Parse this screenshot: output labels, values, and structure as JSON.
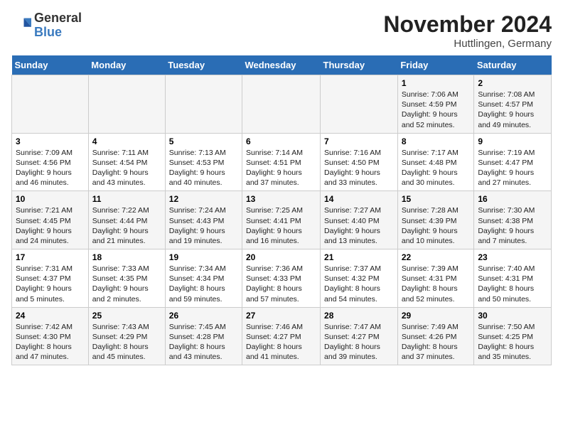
{
  "header": {
    "logo_general": "General",
    "logo_blue": "Blue",
    "month_title": "November 2024",
    "location": "Huttlingen, Germany"
  },
  "days_of_week": [
    "Sunday",
    "Monday",
    "Tuesday",
    "Wednesday",
    "Thursday",
    "Friday",
    "Saturday"
  ],
  "weeks": [
    [
      {
        "day": "",
        "info": ""
      },
      {
        "day": "",
        "info": ""
      },
      {
        "day": "",
        "info": ""
      },
      {
        "day": "",
        "info": ""
      },
      {
        "day": "",
        "info": ""
      },
      {
        "day": "1",
        "info": "Sunrise: 7:06 AM\nSunset: 4:59 PM\nDaylight: 9 hours and 52 minutes."
      },
      {
        "day": "2",
        "info": "Sunrise: 7:08 AM\nSunset: 4:57 PM\nDaylight: 9 hours and 49 minutes."
      }
    ],
    [
      {
        "day": "3",
        "info": "Sunrise: 7:09 AM\nSunset: 4:56 PM\nDaylight: 9 hours and 46 minutes."
      },
      {
        "day": "4",
        "info": "Sunrise: 7:11 AM\nSunset: 4:54 PM\nDaylight: 9 hours and 43 minutes."
      },
      {
        "day": "5",
        "info": "Sunrise: 7:13 AM\nSunset: 4:53 PM\nDaylight: 9 hours and 40 minutes."
      },
      {
        "day": "6",
        "info": "Sunrise: 7:14 AM\nSunset: 4:51 PM\nDaylight: 9 hours and 37 minutes."
      },
      {
        "day": "7",
        "info": "Sunrise: 7:16 AM\nSunset: 4:50 PM\nDaylight: 9 hours and 33 minutes."
      },
      {
        "day": "8",
        "info": "Sunrise: 7:17 AM\nSunset: 4:48 PM\nDaylight: 9 hours and 30 minutes."
      },
      {
        "day": "9",
        "info": "Sunrise: 7:19 AM\nSunset: 4:47 PM\nDaylight: 9 hours and 27 minutes."
      }
    ],
    [
      {
        "day": "10",
        "info": "Sunrise: 7:21 AM\nSunset: 4:45 PM\nDaylight: 9 hours and 24 minutes."
      },
      {
        "day": "11",
        "info": "Sunrise: 7:22 AM\nSunset: 4:44 PM\nDaylight: 9 hours and 21 minutes."
      },
      {
        "day": "12",
        "info": "Sunrise: 7:24 AM\nSunset: 4:43 PM\nDaylight: 9 hours and 19 minutes."
      },
      {
        "day": "13",
        "info": "Sunrise: 7:25 AM\nSunset: 4:41 PM\nDaylight: 9 hours and 16 minutes."
      },
      {
        "day": "14",
        "info": "Sunrise: 7:27 AM\nSunset: 4:40 PM\nDaylight: 9 hours and 13 minutes."
      },
      {
        "day": "15",
        "info": "Sunrise: 7:28 AM\nSunset: 4:39 PM\nDaylight: 9 hours and 10 minutes."
      },
      {
        "day": "16",
        "info": "Sunrise: 7:30 AM\nSunset: 4:38 PM\nDaylight: 9 hours and 7 minutes."
      }
    ],
    [
      {
        "day": "17",
        "info": "Sunrise: 7:31 AM\nSunset: 4:37 PM\nDaylight: 9 hours and 5 minutes."
      },
      {
        "day": "18",
        "info": "Sunrise: 7:33 AM\nSunset: 4:35 PM\nDaylight: 9 hours and 2 minutes."
      },
      {
        "day": "19",
        "info": "Sunrise: 7:34 AM\nSunset: 4:34 PM\nDaylight: 8 hours and 59 minutes."
      },
      {
        "day": "20",
        "info": "Sunrise: 7:36 AM\nSunset: 4:33 PM\nDaylight: 8 hours and 57 minutes."
      },
      {
        "day": "21",
        "info": "Sunrise: 7:37 AM\nSunset: 4:32 PM\nDaylight: 8 hours and 54 minutes."
      },
      {
        "day": "22",
        "info": "Sunrise: 7:39 AM\nSunset: 4:31 PM\nDaylight: 8 hours and 52 minutes."
      },
      {
        "day": "23",
        "info": "Sunrise: 7:40 AM\nSunset: 4:31 PM\nDaylight: 8 hours and 50 minutes."
      }
    ],
    [
      {
        "day": "24",
        "info": "Sunrise: 7:42 AM\nSunset: 4:30 PM\nDaylight: 8 hours and 47 minutes."
      },
      {
        "day": "25",
        "info": "Sunrise: 7:43 AM\nSunset: 4:29 PM\nDaylight: 8 hours and 45 minutes."
      },
      {
        "day": "26",
        "info": "Sunrise: 7:45 AM\nSunset: 4:28 PM\nDaylight: 8 hours and 43 minutes."
      },
      {
        "day": "27",
        "info": "Sunrise: 7:46 AM\nSunset: 4:27 PM\nDaylight: 8 hours and 41 minutes."
      },
      {
        "day": "28",
        "info": "Sunrise: 7:47 AM\nSunset: 4:27 PM\nDaylight: 8 hours and 39 minutes."
      },
      {
        "day": "29",
        "info": "Sunrise: 7:49 AM\nSunset: 4:26 PM\nDaylight: 8 hours and 37 minutes."
      },
      {
        "day": "30",
        "info": "Sunrise: 7:50 AM\nSunset: 4:25 PM\nDaylight: 8 hours and 35 minutes."
      }
    ]
  ]
}
